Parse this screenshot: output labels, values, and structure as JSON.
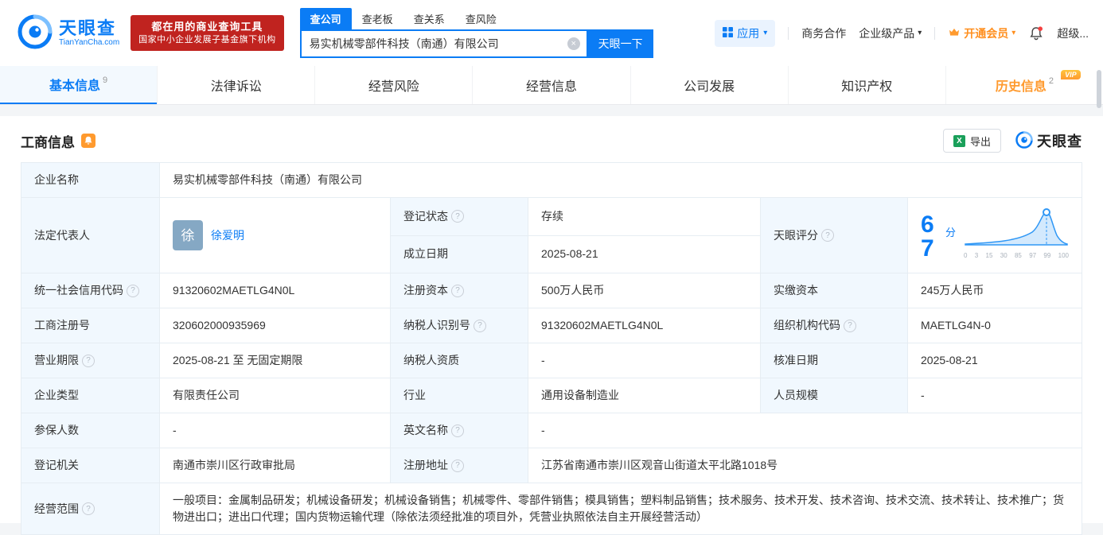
{
  "colors": {
    "accent": "#0b7cf5",
    "vip_orange": "#ff8f1f",
    "status_green": "#00b34a",
    "badge_red": "#c0231f"
  },
  "icons": {
    "help": "?",
    "clear": "×",
    "caret": "▾",
    "excel": "X"
  },
  "header": {
    "brand": "天眼查",
    "brand_domain": "TianYanCha.com",
    "badge_line1": "都在用的商业查询工具",
    "badge_line2": "国家中小企业发展子基金旗下机构",
    "search_tabs": [
      "查公司",
      "查老板",
      "查关系",
      "查风险"
    ],
    "search_value": "易实机械零部件科技（南通）有限公司",
    "search_button": "天眼一下",
    "nav_app": "应用",
    "nav_cooperation": "商务合作",
    "nav_enterprise": "企业级产品",
    "nav_vip": "开通会员",
    "nav_super": "超级..."
  },
  "tabs": {
    "basic": {
      "label": "基本信息",
      "count": "9"
    },
    "legal": {
      "label": "法律诉讼"
    },
    "risk": {
      "label": "经营风险"
    },
    "operation": {
      "label": "经营信息"
    },
    "development": {
      "label": "公司发展"
    },
    "ip": {
      "label": "知识产权"
    },
    "history": {
      "label": "历史信息",
      "count": "2",
      "vip": "VIP"
    }
  },
  "section": {
    "title": "工商信息",
    "export_label": "导出",
    "brand_stamp": "天眼查"
  },
  "info": {
    "company_name": {
      "label": "企业名称",
      "value": "易实机械零部件科技（南通）有限公司"
    },
    "legal_rep": {
      "label": "法定代表人",
      "avatar": "徐",
      "name": "徐爱明"
    },
    "reg_status": {
      "label": "登记状态",
      "value": "存续"
    },
    "establish_date": {
      "label": "成立日期",
      "value": "2025-08-21"
    },
    "score": {
      "label": "天眼评分",
      "value": "67",
      "unit": "分",
      "axis": [
        "0",
        "3",
        "15",
        "30",
        "85",
        "97",
        "99",
        "100"
      ]
    },
    "credit_code": {
      "label": "统一社会信用代码",
      "value": "91320602MAETLG4N0L"
    },
    "reg_capital": {
      "label": "注册资本",
      "value": "500万人民币"
    },
    "paid_capital": {
      "label": "实缴资本",
      "value": "245万人民币"
    },
    "reg_number": {
      "label": "工商注册号",
      "value": "320602000935969"
    },
    "taxpayer_id": {
      "label": "纳税人识别号",
      "value": "91320602MAETLG4N0L"
    },
    "org_code": {
      "label": "组织机构代码",
      "value": "MAETLG4N-0"
    },
    "business_term": {
      "label": "营业期限",
      "value": "2025-08-21 至 无固定期限"
    },
    "taxpayer_quality": {
      "label": "纳税人资质",
      "value": "-"
    },
    "approval_date": {
      "label": "核准日期",
      "value": "2025-08-21"
    },
    "company_type": {
      "label": "企业类型",
      "value": "有限责任公司"
    },
    "industry": {
      "label": "行业",
      "value": "通用设备制造业"
    },
    "staff_size": {
      "label": "人员规模",
      "value": "-"
    },
    "insured_count": {
      "label": "参保人数",
      "value": "-"
    },
    "english_name": {
      "label": "英文名称",
      "value": "-"
    },
    "reg_authority": {
      "label": "登记机关",
      "value": "南通市崇川区行政审批局"
    },
    "reg_address": {
      "label": "注册地址",
      "value": "江苏省南通市崇川区观音山街道太平北路1018号"
    },
    "business_scope": {
      "label": "经营范围",
      "value": "一般项目：金属制品研发；机械设备研发；机械设备销售；机械零件、零部件销售；模具销售；塑料制品销售；技术服务、技术开发、技术咨询、技术交流、技术转让、技术推广；货物进出口；进出口代理；国内货物运输代理（除依法须经批准的项目外，凭营业执照依法自主开展经营活动）"
    }
  }
}
